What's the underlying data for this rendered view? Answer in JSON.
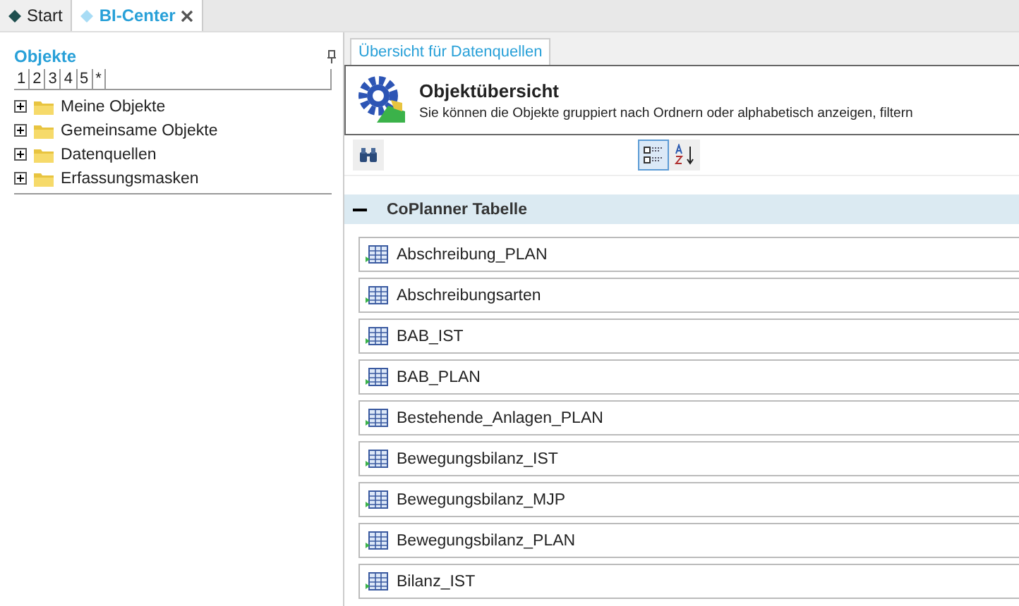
{
  "doc_tabs": [
    {
      "label": "Start",
      "selected": false
    },
    {
      "label": "BI-Center",
      "selected": true
    }
  ],
  "objects_panel": {
    "title": "Objekte",
    "level_tabs": [
      "1",
      "2",
      "3",
      "4",
      "5",
      "*"
    ],
    "tree": [
      {
        "label": "Meine Objekte",
        "expanded": false
      },
      {
        "label": "Gemeinsame Objekte",
        "expanded": false
      },
      {
        "label": "Datenquellen",
        "expanded": false
      },
      {
        "label": "Erfassungsmasken",
        "expanded": false
      }
    ]
  },
  "content": {
    "tab": "Übersicht für Datenquellen",
    "header": {
      "title": "Objektübersicht",
      "description": "Sie können die Objekte gruppiert nach Ordnern oder alphabetisch anzeigen, filtern"
    },
    "toolbar": [
      {
        "kind": "search",
        "selected": false
      },
      {
        "kind": "group",
        "selected": true
      },
      {
        "kind": "sort",
        "selected": false
      }
    ],
    "group": {
      "title": "CoPlanner Tabelle",
      "expanded": true,
      "items": [
        "Abschreibung_PLAN",
        "Abschreibungsarten",
        "BAB_IST",
        "BAB_PLAN",
        "Bestehende_Anlagen_PLAN",
        "Bewegungsbilanz_IST",
        "Bewegungsbilanz_MJP",
        "Bewegungsbilanz_PLAN",
        "Bilanz_IST"
      ]
    }
  }
}
